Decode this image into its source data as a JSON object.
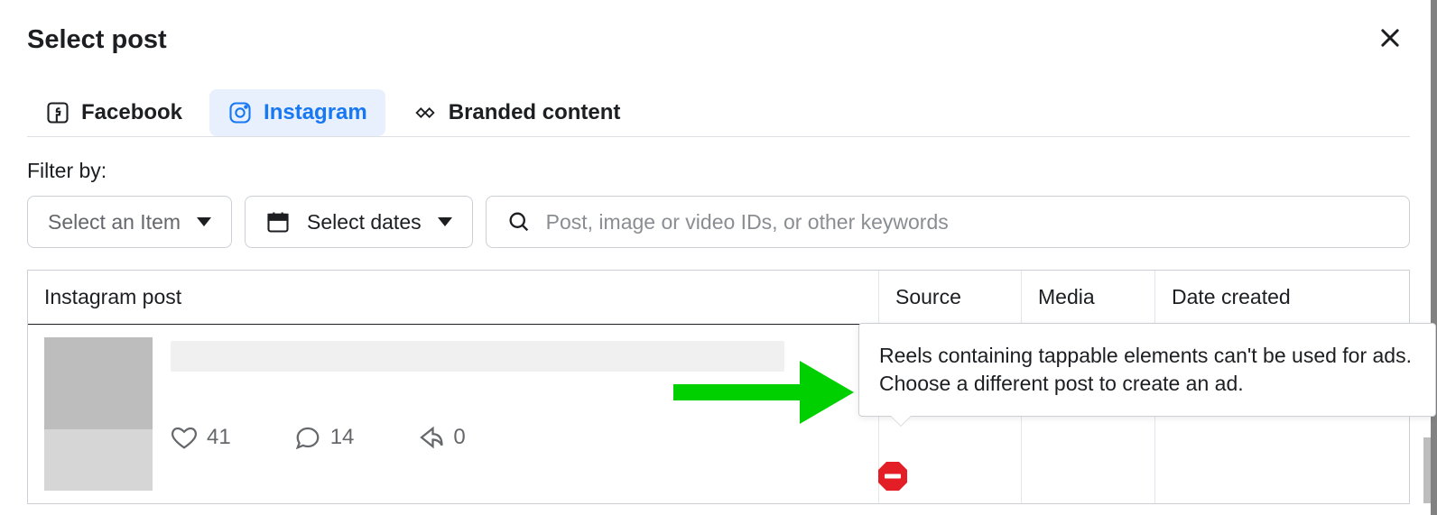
{
  "dialog": {
    "title": "Select post"
  },
  "tabs": [
    {
      "key": "facebook",
      "label": "Facebook",
      "active": false
    },
    {
      "key": "instagram",
      "label": "Instagram",
      "active": true
    },
    {
      "key": "branded",
      "label": "Branded content",
      "active": false
    }
  ],
  "filter": {
    "label": "Filter by:",
    "item_select_placeholder": "Select an Item",
    "date_select_label": "Select dates",
    "search_placeholder": "Post, image or video IDs, or other keywords"
  },
  "table": {
    "columns": {
      "post": "Instagram post",
      "source": "Source",
      "media": "Media",
      "date_created": "Date created"
    },
    "rows": [
      {
        "likes": "41",
        "comments": "14",
        "shares": "0",
        "source": "",
        "media": "",
        "date_created": "",
        "restricted": true
      }
    ]
  },
  "tooltip": {
    "text": "Reels containing tappable elements can't be used for ads. Choose a different post to create an ad."
  },
  "icons": {
    "close": "close-icon",
    "facebook": "facebook-icon",
    "instagram": "instagram-icon",
    "branded": "handshake-icon",
    "calendar": "calendar-icon",
    "search": "search-icon",
    "chevron_down": "chevron-down-icon",
    "heart": "heart-icon",
    "comment": "comment-icon",
    "share": "share-icon",
    "restricted": "restricted-icon"
  }
}
